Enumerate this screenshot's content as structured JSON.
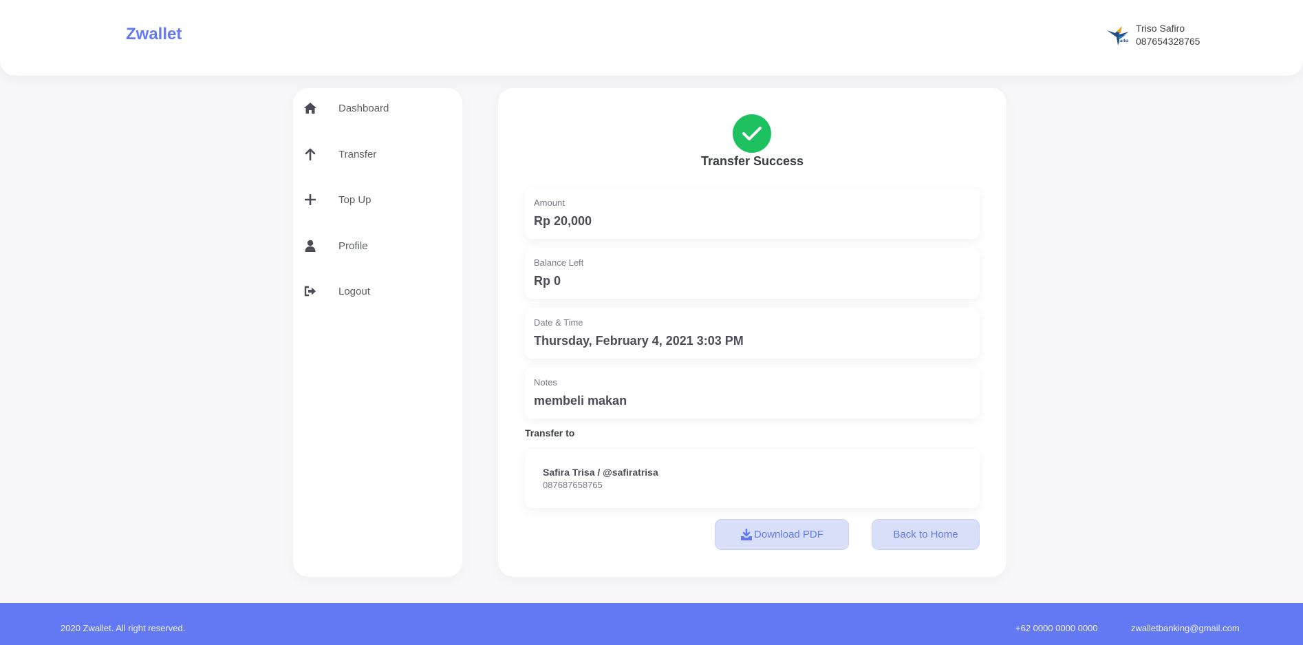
{
  "header": {
    "brand": "Zwallet",
    "user_name": "Triso Safiro",
    "user_phone": "087654328765"
  },
  "sidebar": {
    "items": [
      {
        "label": "Dashboard",
        "icon": "home-icon"
      },
      {
        "label": "Transfer",
        "icon": "arrow-up-icon"
      },
      {
        "label": "Top Up",
        "icon": "plus-icon"
      },
      {
        "label": "Profile",
        "icon": "user-icon"
      },
      {
        "label": "Logout",
        "icon": "logout-icon"
      }
    ]
  },
  "main": {
    "status_title": "Transfer Success",
    "details": [
      {
        "label": "Amount",
        "value": "Rp 20,000"
      },
      {
        "label": "Balance Left",
        "value": "Rp 0"
      },
      {
        "label": "Date & Time",
        "value": "Thursday, February 4, 2021 3:03 PM"
      },
      {
        "label": "Notes",
        "value": "membeli makan"
      }
    ],
    "transfer_to_label": "Transfer to",
    "recipient": {
      "name": "Safira Trisa / @safiratrisa",
      "phone": "087687658765"
    },
    "download_button": "Download PDF",
    "home_button": "Back to Home"
  },
  "footer": {
    "copyright": "2020 Zwallet. All right reserved.",
    "phone": "+62 0000 0000 0000",
    "email": "zwalletbanking@gmail.com"
  },
  "colors": {
    "primary": "#6379f4",
    "success": "#1ec15f",
    "background": "#f7f7fa"
  }
}
